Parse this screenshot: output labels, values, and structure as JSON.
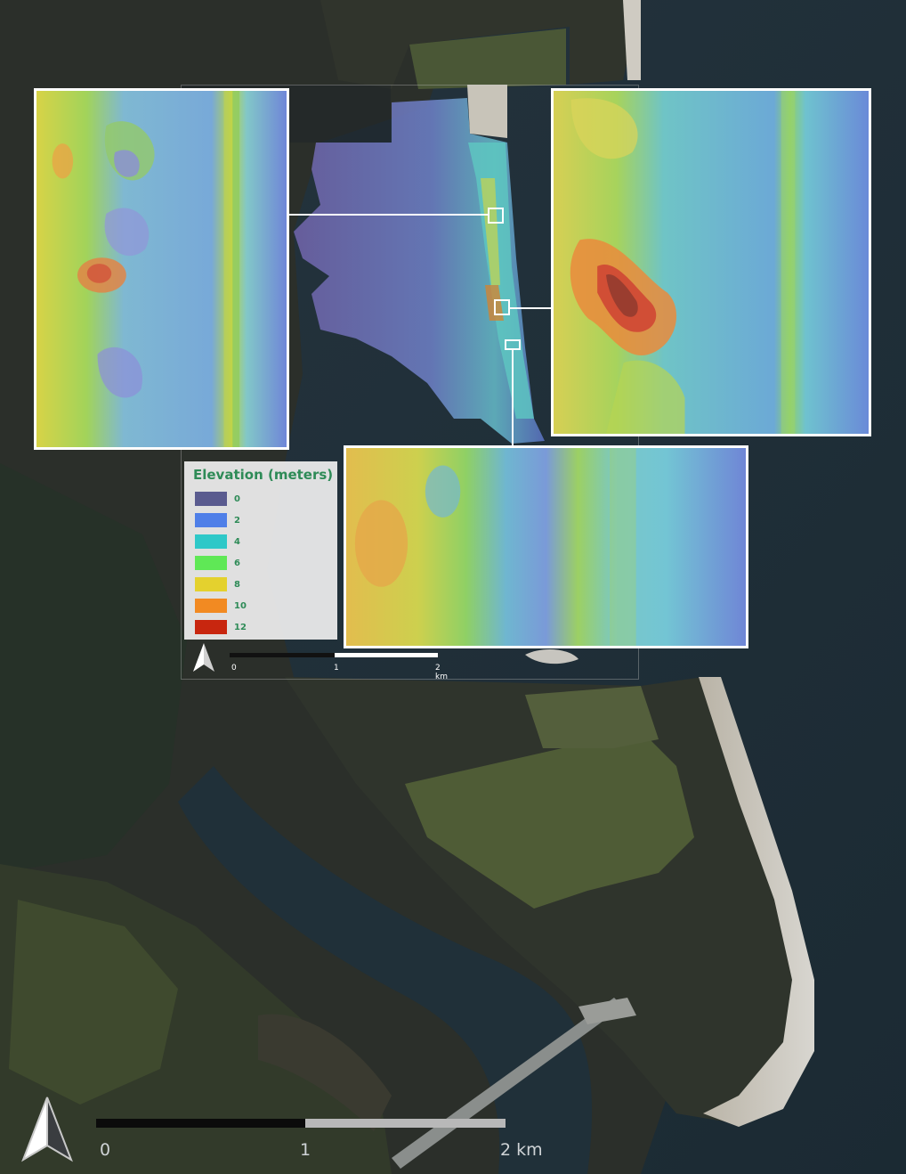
{
  "legend": {
    "title": "Elevation (meters)",
    "classes": [
      {
        "label": "0",
        "color": "#5a5b8f"
      },
      {
        "label": "2",
        "color": "#4f7fe8"
      },
      {
        "label": "4",
        "color": "#2ec8c8"
      },
      {
        "label": "6",
        "color": "#5fe856"
      },
      {
        "label": "8",
        "color": "#e4d12e"
      },
      {
        "label": "10",
        "color": "#f28a22"
      },
      {
        "label": "12",
        "color": "#c8260f"
      }
    ]
  },
  "inner_scale": {
    "ticks": [
      "0",
      "1",
      "2 km"
    ]
  },
  "main_scale": {
    "ticks": [
      "0",
      "1",
      "2 km"
    ]
  },
  "icons": {
    "north": "north-arrow-icon"
  },
  "colors": {
    "water": "#1e2e38",
    "land_dark": "#2a2e28",
    "vegetation": "#4d5a3a",
    "sand": "#c9c6bd",
    "inset_border": "#ffffff",
    "legend_text": "#2e8b57"
  }
}
